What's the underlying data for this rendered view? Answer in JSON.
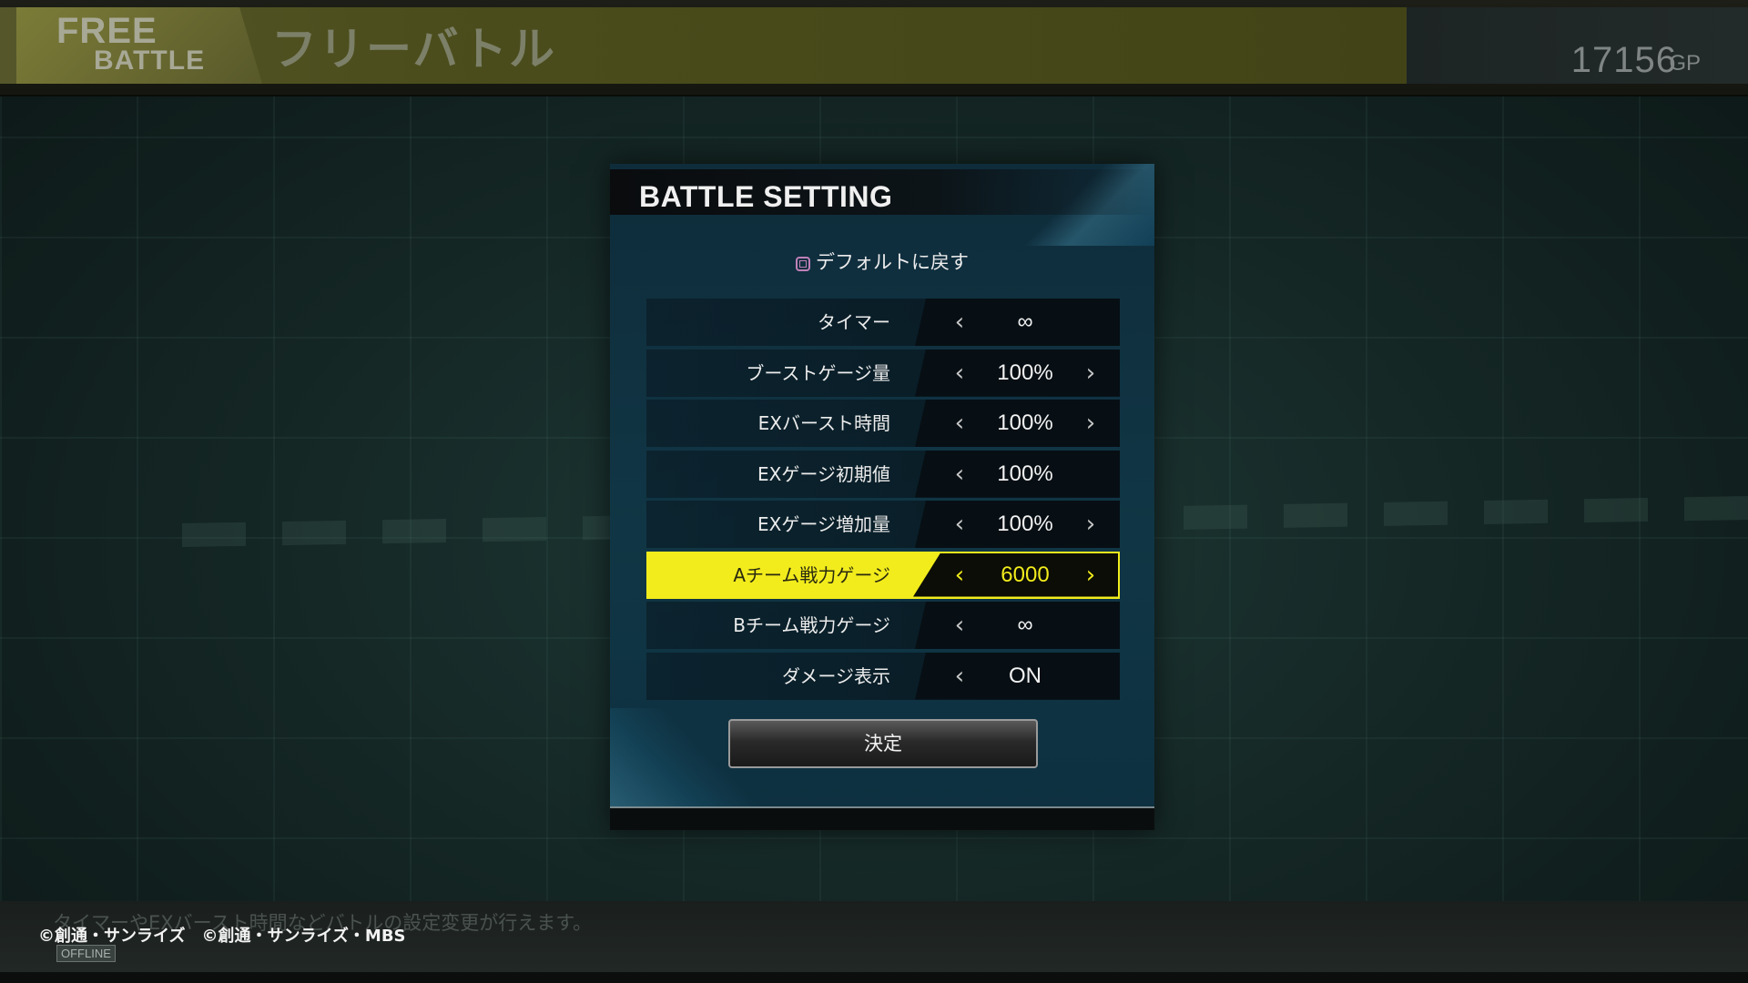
{
  "header": {
    "badge_line1": "FREE",
    "badge_line2": "BATTLE",
    "title": "フリーバトル",
    "gp_value": "17156",
    "gp_unit": "GP"
  },
  "panel": {
    "title": "BATTLE SETTING",
    "reset_label": "デフォルトに戻す",
    "rows": [
      {
        "label": "タイマー",
        "value": "∞",
        "left_arrow": "‹",
        "right_arrow": ""
      },
      {
        "label": "ブーストゲージ量",
        "value": "100%",
        "left_arrow": "‹",
        "right_arrow": "›"
      },
      {
        "label": "EXバースト時間",
        "value": "100%",
        "left_arrow": "‹",
        "right_arrow": "›"
      },
      {
        "label": "EXゲージ初期値",
        "value": "100%",
        "left_arrow": "‹",
        "right_arrow": ""
      },
      {
        "label": "EXゲージ増加量",
        "value": "100%",
        "left_arrow": "‹",
        "right_arrow": "›"
      },
      {
        "label": "Aチーム戦力ゲージ",
        "value": "6000",
        "left_arrow": "‹",
        "right_arrow": "›"
      },
      {
        "label": "Bチーム戦力ゲージ",
        "value": "∞",
        "left_arrow": "‹",
        "right_arrow": ""
      },
      {
        "label": "ダメージ表示",
        "value": "ON",
        "left_arrow": "‹",
        "right_arrow": ""
      }
    ],
    "confirm_label": "決定"
  },
  "footer": {
    "help_text": "タイマーやEXバースト時間などバトルの設定変更が行えます。",
    "copyright": "©創通・サンライズ　©創通・サンライズ・MBS",
    "offline": "OFFLINE"
  },
  "colors": {
    "highlight": "#f2ec1c",
    "panel_bg": "#103645"
  }
}
